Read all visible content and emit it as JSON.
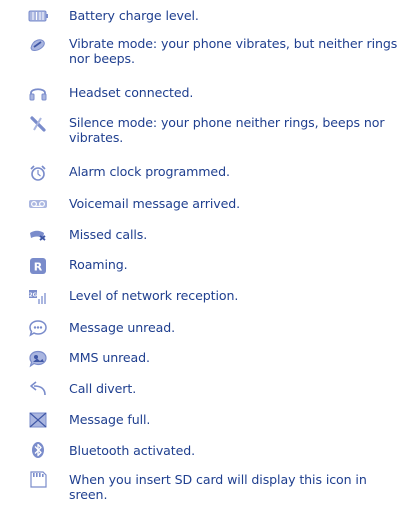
{
  "colors": {
    "text": "#1f3f8f",
    "icon": "#7a8ccb",
    "icon_fill": "#aab6e0"
  },
  "items": [
    {
      "icon": "battery-icon",
      "text": "Battery charge level."
    },
    {
      "icon": "vibrate-icon",
      "text": "Vibrate mode: your phone vibrates, but neither rings nor beeps."
    },
    {
      "icon": "headset-icon",
      "text": "Headset connected."
    },
    {
      "icon": "silence-icon",
      "text": "Silence mode: your phone neither rings, beeps nor vibrates."
    },
    {
      "icon": "alarm-clock-icon",
      "text": "Alarm clock programmed."
    },
    {
      "icon": "voicemail-icon",
      "text": "Voicemail message arrived."
    },
    {
      "icon": "missed-call-icon",
      "text": "Missed calls."
    },
    {
      "icon": "roaming-icon",
      "text": "Roaming."
    },
    {
      "icon": "signal-strength-icon",
      "text": "Level of network reception."
    },
    {
      "icon": "message-unread-icon",
      "text": "Message unread."
    },
    {
      "icon": "mms-unread-icon",
      "text": "MMS unread."
    },
    {
      "icon": "call-divert-icon",
      "text": "Call divert."
    },
    {
      "icon": "message-full-icon",
      "text": "Message full."
    },
    {
      "icon": "bluetooth-icon",
      "text": "Bluetooth activated."
    },
    {
      "icon": "sd-card-icon",
      "text": "When you insert SD card will display  this icon in sreen."
    }
  ]
}
